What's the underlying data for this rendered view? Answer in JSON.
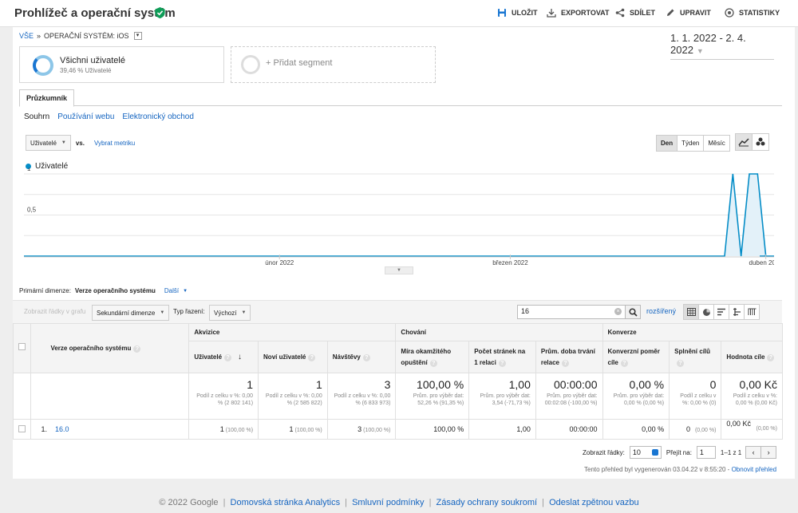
{
  "header": {
    "title": "Prohlížeč a operační systém",
    "buttons": {
      "save": "ULOŽIT",
      "export": "EXPORTOVAT",
      "share": "SDÍLET",
      "edit": "UPRAVIT",
      "insights": "STATISTIKY"
    }
  },
  "breadcrumb": {
    "all": "VŠE",
    "separator": "»",
    "current": "OPERAČNÍ SYSTÉM: iOS"
  },
  "date_range": "1. 1. 2022 - 2. 4. 2022",
  "segments": {
    "active": {
      "title": "Všichni uživatelé",
      "subtitle": "39,46 % Uživatelé"
    },
    "add": "+ Přidat segment"
  },
  "tabs": {
    "explorer": "Průzkumník"
  },
  "subtabs": {
    "summary": "Souhrn",
    "site_usage": "Používání webu",
    "ecommerce": "Elektronický obchod"
  },
  "chart_controls": {
    "metric": "Uživatelé",
    "vs": "vs.",
    "select_metric": "Vybrat metriku"
  },
  "period": {
    "day": "Den",
    "week": "Týden",
    "month": "Měsíc"
  },
  "chart_data": {
    "type": "area",
    "series": [
      {
        "name": "Uživatelé",
        "color": "#058dc7"
      }
    ],
    "y_ticks": [
      "1",
      "0,5"
    ],
    "ylim": [
      0,
      1
    ],
    "x_labels": [
      "únor 2022",
      "březen 2022",
      "duben 2022"
    ],
    "x": [
      "2022-01-01",
      "2022-03-27",
      "2022-03-28",
      "2022-03-29",
      "2022-03-30",
      "2022-03-31",
      "2022-04-01",
      "2022-04-02"
    ],
    "values": [
      0,
      0,
      1,
      0,
      1,
      1,
      0,
      0
    ],
    "xlim": [
      "2022-01-01",
      "2022-04-02"
    ]
  },
  "dimension": {
    "label": "Primární dimenze:",
    "value": "Verze operačního systému",
    "more": "Další"
  },
  "toolbar": {
    "plot_rows": "Zobrazit řádky v grafu",
    "secondary_dim": "Sekundární dimenze",
    "sort_label": "Typ řazení:",
    "sort_value": "Výchozí",
    "search_value": "16",
    "advanced": "rozšířený"
  },
  "table": {
    "dim_header": "Verze operačního systému",
    "groups": [
      "Akvizice",
      "Chování",
      "Konverze"
    ],
    "columns": [
      "Uživatelé",
      "Noví uživatelé",
      "Návštěvy",
      "Míra okamžitého opuštění",
      "Počet stránek na 1 relaci",
      "Prům. doba trvání relace",
      "Konverzní poměr cíle",
      "Splnění cílů",
      "Hodnota cíle"
    ],
    "totals": [
      {
        "value": "1",
        "note": "Podíl z celku v %: 0,00 % (2 802 141)"
      },
      {
        "value": "1",
        "note": "Podíl z celku v %: 0,00 % (2 585 822)"
      },
      {
        "value": "3",
        "note": "Podíl z celku v %: 0,00 % (6 833 973)"
      },
      {
        "value": "100,00 %",
        "note": "Prům. pro výběr dat: 52,26 % (91,35 %)"
      },
      {
        "value": "1,00",
        "note": "Prům. pro výběr dat: 3,54 (-71,73 %)"
      },
      {
        "value": "00:00:00",
        "note": "Prům. pro výběr dat: 00:02:08 (-100,00 %)"
      },
      {
        "value": "0,00 %",
        "note": "Prům. pro výběr dat: 0,00 % (0,00 %)"
      },
      {
        "value": "0",
        "note": "Podíl z celku v %: 0,00 % (0)"
      },
      {
        "value": "0,00 Kč",
        "note": "Podíl z celku v %: 0,00 % (0,00 Kč)"
      }
    ],
    "rows": [
      {
        "index": "1.",
        "name": "16.0",
        "users": "1",
        "users_pct": "(100,00 %)",
        "new_users": "1",
        "new_users_pct": "(100,00 %)",
        "sessions": "3",
        "sessions_pct": "(100,00 %)",
        "bounce": "100,00 %",
        "pages": "1,00",
        "duration": "00:00:00",
        "conv_rate": "0,00 %",
        "completions": "0",
        "completions_pct": "(0,00 %)",
        "value": "0,00 Kč",
        "value_pct": "(0,00 %)"
      }
    ]
  },
  "pagination": {
    "show_rows": "Zobrazit řádky:",
    "rows_value": "10",
    "goto": "Přejít na:",
    "goto_value": "1",
    "range": "1–1 z 1",
    "prev": "‹",
    "next": "›"
  },
  "generated": {
    "text": "Tento přehled byl vygenerován 03.04.22 v 8:55:20 - ",
    "refresh": "Obnovit přehled"
  },
  "footer": {
    "copyright": "© 2022 Google",
    "links": [
      "Domovská stránka Analytics",
      "Smluvní podmínky",
      "Zásady ochrany soukromí",
      "Odeslat zpětnou vazbu"
    ]
  },
  "colors": {
    "accent": "#1565c0",
    "series": "#058dc7",
    "verified": "#0f9d58"
  }
}
